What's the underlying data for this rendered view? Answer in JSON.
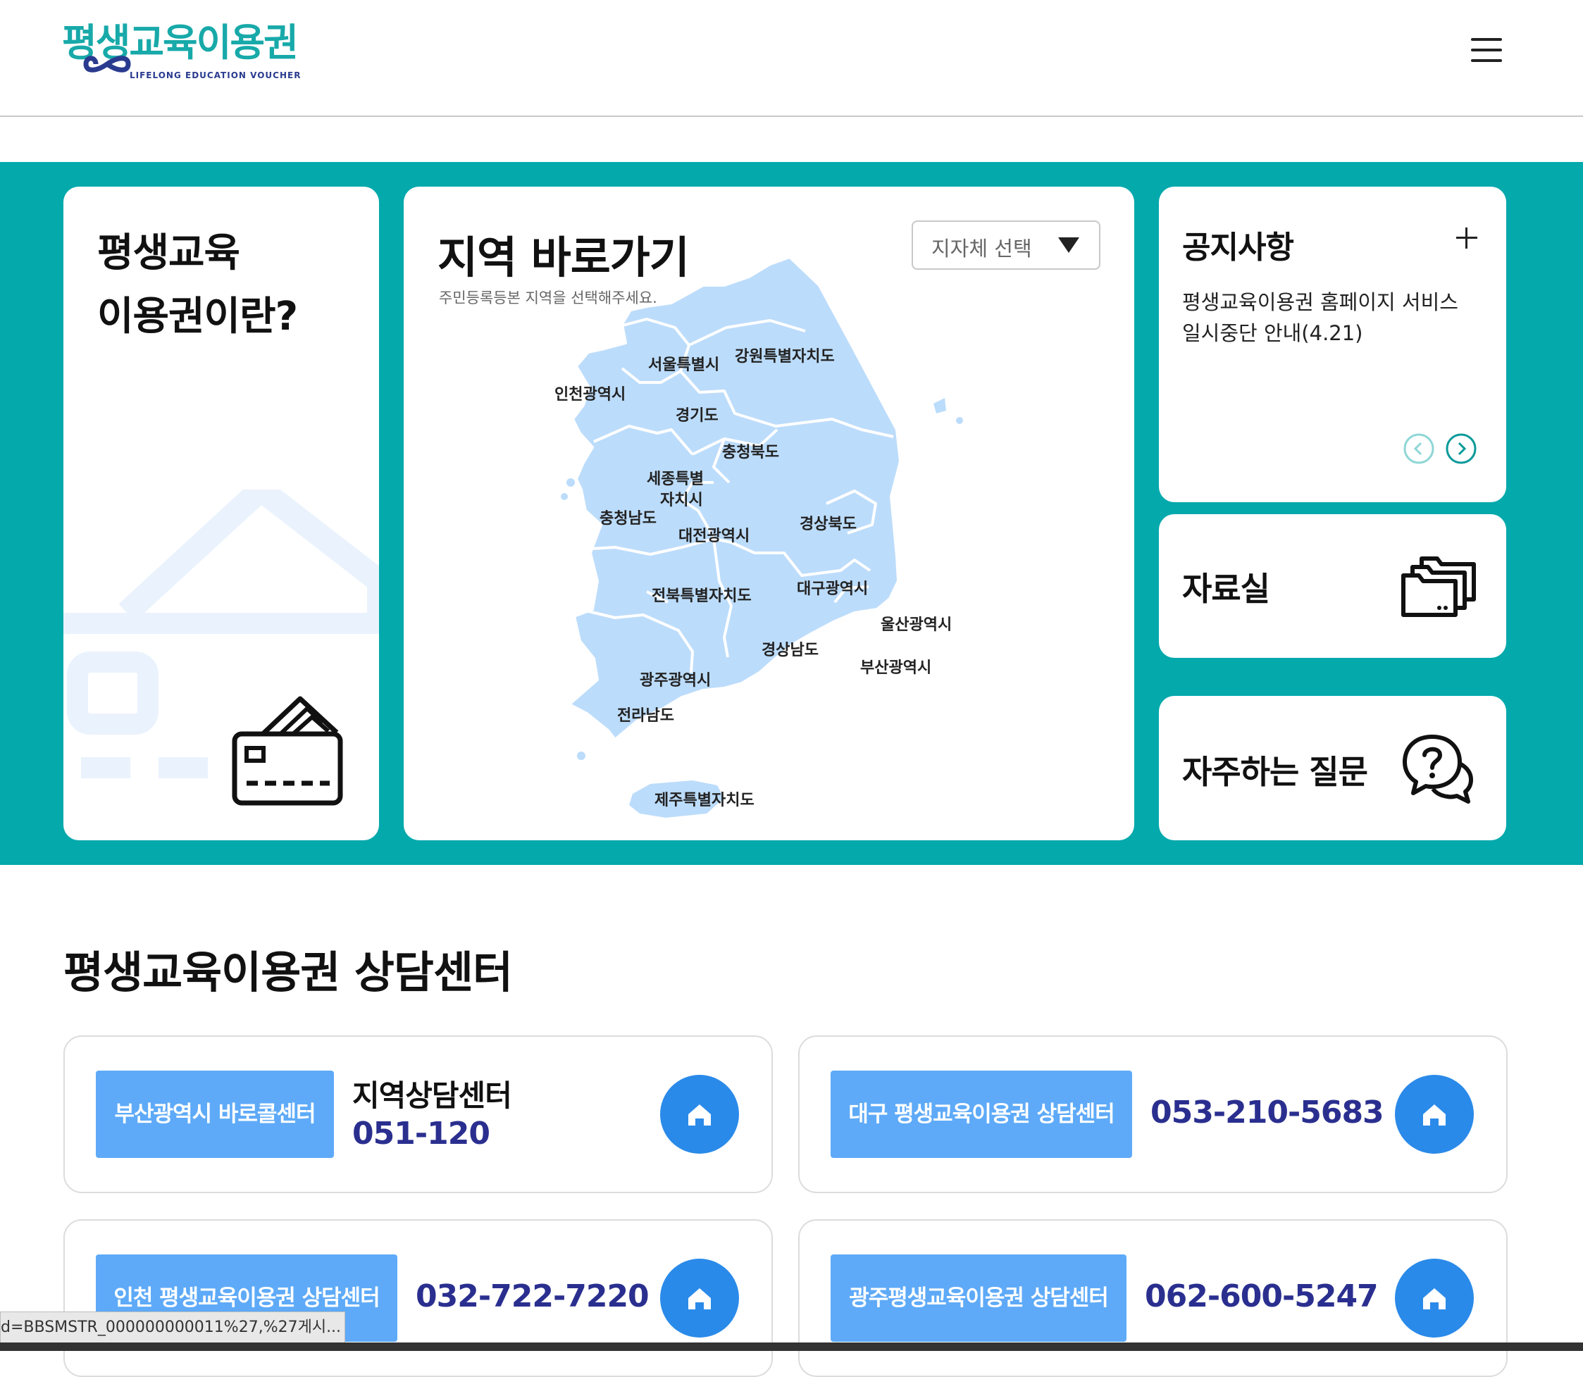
{
  "header": {
    "logo_text": "평생교육이용권",
    "logo_subtext": "LIFELONG EDUCATION VOUCHER",
    "menu_icon": "hamburger-icon"
  },
  "intro": {
    "title_line1": "평생교육",
    "title_line2": "이용권이란?",
    "icon": "credit-card-icon"
  },
  "region": {
    "title": "지역 바로가기",
    "subtitle": "주민등록등본 지역을 선택해주세요.",
    "select_value": "지자체 선택",
    "labels": {
      "seoul": "서울특별시",
      "gangwon": "강원특별자치도",
      "incheon": "인천광역시",
      "gyeonggi": "경기도",
      "chungbuk": "충청북도",
      "sejong1": "세종특별",
      "sejong2": "자치시",
      "chungnam": "충청남도",
      "daejeon": "대전광역시",
      "gyeongbuk": "경상북도",
      "daegu": "대구광역시",
      "jeonbuk": "전북특별자치도",
      "ulsan": "울산광역시",
      "gyeongnam": "경상남도",
      "busan": "부산광역시",
      "gwangju": "광주광역시",
      "jeonnam": "전라남도",
      "jeju": "제주특별자치도"
    },
    "map_color": "#bcdcfb"
  },
  "notice": {
    "title": "공지사항",
    "text": "평생교육이용권 홈페이지 서비스 일시중단 안내(4.21)"
  },
  "archive": {
    "title": "자료실",
    "icon": "folders-icon"
  },
  "faq": {
    "title": "자주하는 질문",
    "icon": "question-bubble-icon"
  },
  "consult": {
    "title": "평생교육이용권 상담센터",
    "centers": [
      {
        "badge": "부산광역시 바로콜센터",
        "name": "지역상담센터",
        "phone": "051-120"
      },
      {
        "badge": "대구 평생교육이용권 상담센터",
        "phone": "053-210-5683"
      },
      {
        "badge": "인천 평생교육이용권 상담센터",
        "phone": "032-722-7220"
      },
      {
        "badge": "광주평생교육이용권 상담센터",
        "phone": "062-600-5247"
      }
    ]
  },
  "statusbar": {
    "text": "d=BBSMSTR_000000000011%27,%27게시..."
  },
  "colors": {
    "teal": "#04a9ac",
    "badge": "#5eaaf8",
    "home_button": "#2a8ae9",
    "phone": "#2a2f8f"
  }
}
